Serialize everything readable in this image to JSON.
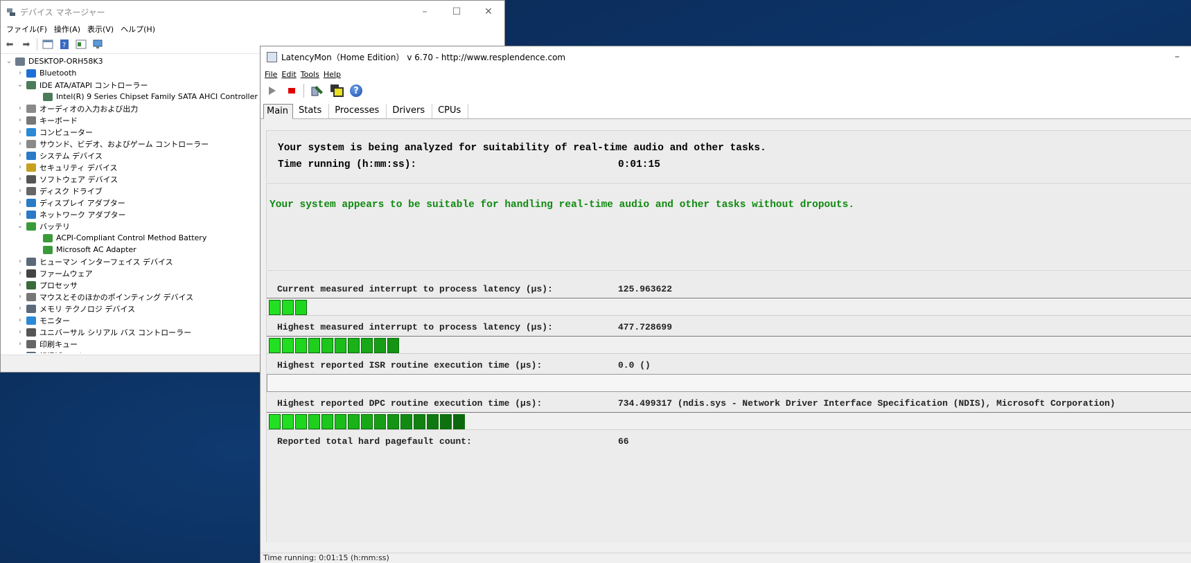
{
  "device_manager": {
    "title": "デバイス マネージャー",
    "menu": [
      "ファイル(F)",
      "操作(A)",
      "表示(V)",
      "ヘルプ(H)"
    ],
    "tree": [
      {
        "label": "DESKTOP-ORH58K3",
        "level": 0,
        "expander": "⌄",
        "icon_color": "#6b7b8c"
      },
      {
        "label": "Bluetooth",
        "level": 1,
        "expander": "›",
        "icon_color": "#1f6fd6"
      },
      {
        "label": "IDE ATA/ATAPI コントローラー",
        "level": 1,
        "expander": "⌄",
        "icon_color": "#4a7c59"
      },
      {
        "label": "Intel(R) 9 Series Chipset Family SATA AHCI Controller",
        "level": 2,
        "expander": "",
        "icon_color": "#4a7c59"
      },
      {
        "label": "オーディオの入力および出力",
        "level": 1,
        "expander": "›",
        "icon_color": "#8a8a8a"
      },
      {
        "label": "キーボード",
        "level": 1,
        "expander": "›",
        "icon_color": "#777777"
      },
      {
        "label": "コンピューター",
        "level": 1,
        "expander": "›",
        "icon_color": "#2a8ad6"
      },
      {
        "label": "サウンド、ビデオ、およびゲーム コントローラー",
        "level": 1,
        "expander": "›",
        "icon_color": "#8a8a8a"
      },
      {
        "label": "システム デバイス",
        "level": 1,
        "expander": "›",
        "icon_color": "#2a7ac6"
      },
      {
        "label": "セキュリティ デバイス",
        "level": 1,
        "expander": "›",
        "icon_color": "#c8a020"
      },
      {
        "label": "ソフトウェア デバイス",
        "level": 1,
        "expander": "›",
        "icon_color": "#555555"
      },
      {
        "label": "ディスク ドライブ",
        "level": 1,
        "expander": "›",
        "icon_color": "#666666"
      },
      {
        "label": "ディスプレイ アダプター",
        "level": 1,
        "expander": "›",
        "icon_color": "#2a7ac6"
      },
      {
        "label": "ネットワーク アダプター",
        "level": 1,
        "expander": "›",
        "icon_color": "#2a7ac6"
      },
      {
        "label": "バッテリ",
        "level": 1,
        "expander": "⌄",
        "icon_color": "#3a9a3a"
      },
      {
        "label": "ACPI-Compliant Control Method Battery",
        "level": 2,
        "expander": "",
        "icon_color": "#3a9a3a"
      },
      {
        "label": "Microsoft AC Adapter",
        "level": 2,
        "expander": "",
        "icon_color": "#3a9a3a"
      },
      {
        "label": "ヒューマン インターフェイス デバイス",
        "level": 1,
        "expander": "›",
        "icon_color": "#5a6a7a"
      },
      {
        "label": "ファームウェア",
        "level": 1,
        "expander": "›",
        "icon_color": "#444444"
      },
      {
        "label": "プロセッサ",
        "level": 1,
        "expander": "›",
        "icon_color": "#3a6a3a"
      },
      {
        "label": "マウスとそのほかのポインティング デバイス",
        "level": 1,
        "expander": "›",
        "icon_color": "#777777"
      },
      {
        "label": "メモリ テクノロジ デバイス",
        "level": 1,
        "expander": "›",
        "icon_color": "#5a6a7a"
      },
      {
        "label": "モニター",
        "level": 1,
        "expander": "›",
        "icon_color": "#2a8ad6"
      },
      {
        "label": "ユニバーサル シリアル バス コントローラー",
        "level": 1,
        "expander": "›",
        "icon_color": "#555555"
      },
      {
        "label": "印刷キュー",
        "level": 1,
        "expander": "›",
        "icon_color": "#666666"
      },
      {
        "label": "記憶域コントローラー",
        "level": 1,
        "expander": "›",
        "icon_color": "#5a6a7a"
      }
    ]
  },
  "latencymon": {
    "title": "LatencyMon（Home Edition） v 6.70 - http://www.resplendence.com",
    "menu": [
      "File",
      "Edit",
      "Tools",
      "Help"
    ],
    "tabs": [
      "Main",
      "Stats",
      "Processes",
      "Drivers",
      "CPUs"
    ],
    "active_tab": "Main",
    "analysis_heading": "Your system is being analyzed for suitability of real-time audio and other tasks.",
    "time_running_label": "Time running (h:mm:ss):",
    "time_running_value": "0:01:15",
    "verdict": "Your system appears to be suitable for handling real-time audio and other tasks without dropouts.",
    "verdict_color": "#108a10",
    "metrics": [
      {
        "label": "Current measured interrupt to process latency (µs):",
        "value": "125.963622",
        "bar_segments": 3
      },
      {
        "label": "Highest measured interrupt to process latency (µs):",
        "value": "477.728699",
        "bar_segments": 10
      },
      {
        "label": "Highest reported ISR routine execution time (µs):",
        "value": "0.0  ()",
        "bar_segments": 0
      },
      {
        "label": "Highest reported DPC routine execution time (µs):",
        "value": "734.499317  (ndis.sys - Network Driver Interface Specification (NDIS), Microsoft Corporation)",
        "bar_segments": 15
      },
      {
        "label": "Reported total hard pagefault count:",
        "value": "66",
        "bar_segments": null
      }
    ],
    "status": "Time running: 0:01:15  (h:mm:ss)"
  }
}
